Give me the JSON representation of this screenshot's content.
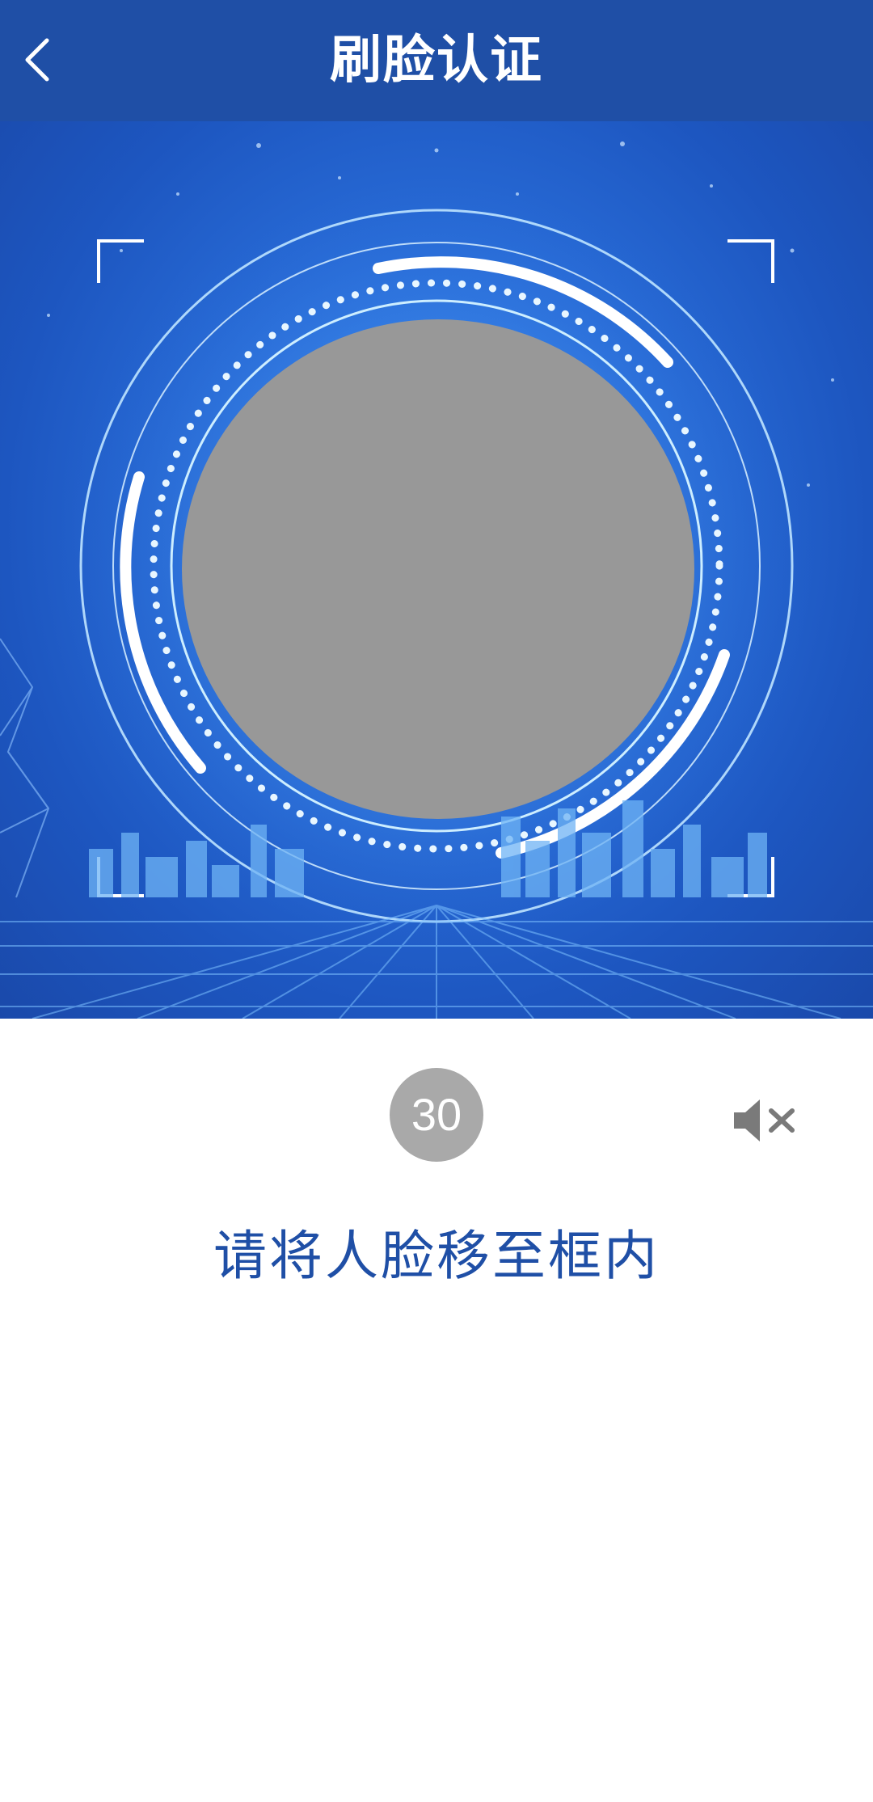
{
  "header": {
    "title": "刷脸认证",
    "back_icon": "chevron-left-icon",
    "background": "#1f4fa6"
  },
  "scanner": {
    "background_accent": "#2a6fdb",
    "preview_color": "#989898"
  },
  "controls": {
    "countdown": "30",
    "sound_icon": "speaker-muted-icon"
  },
  "hint": {
    "text": "请将人脸移至框内",
    "color": "#1f4fa6"
  }
}
